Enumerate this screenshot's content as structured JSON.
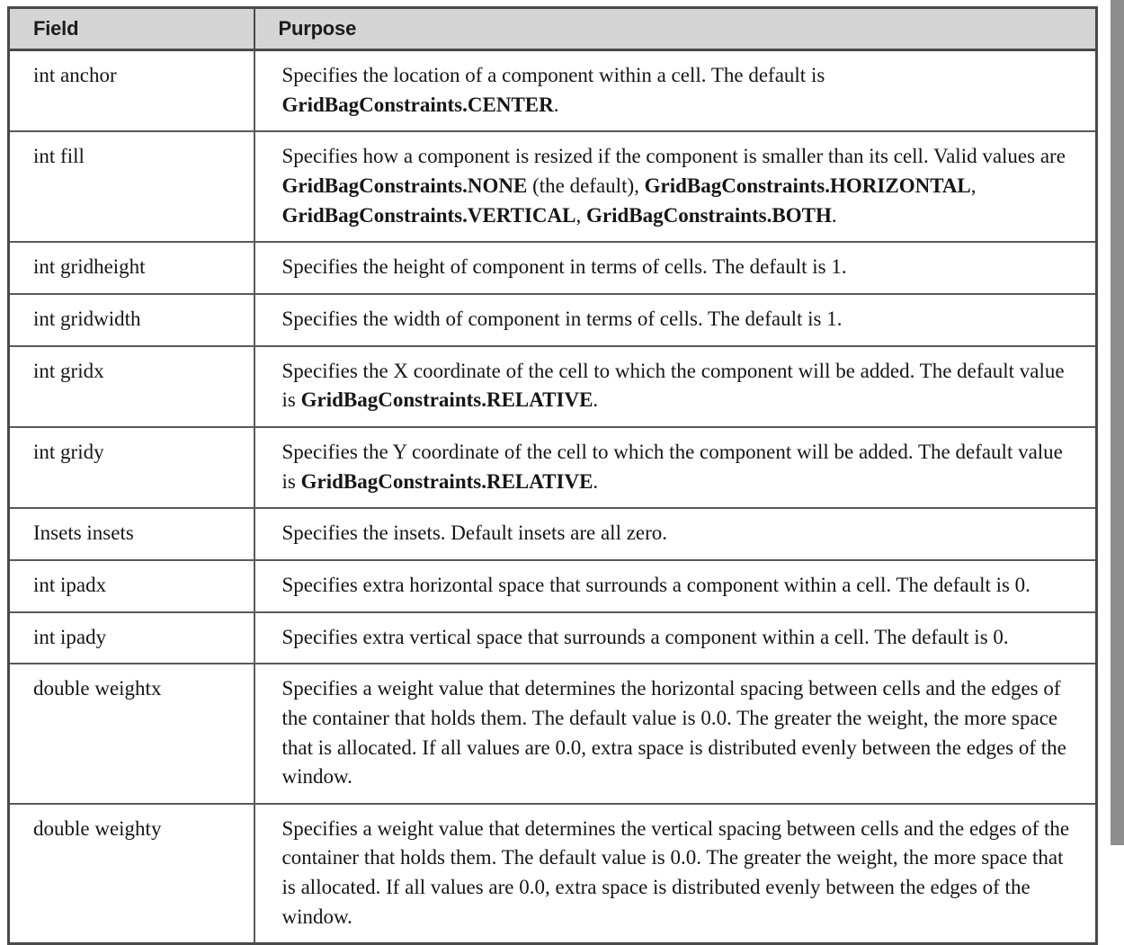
{
  "table": {
    "columns": [
      {
        "key": "field",
        "label": "Field"
      },
      {
        "key": "purpose",
        "label": "Purpose"
      }
    ],
    "colors": {
      "header_background": "#d5d5d5",
      "header_text": "#1b1b1b",
      "body_text": "#161616",
      "border": "#4a4a4a",
      "inner_border": "#5a5a5a",
      "page_background": "#ffffff",
      "page_edge": "#8e8e8e"
    },
    "rows": [
      {
        "field": "int anchor",
        "purpose_parts": [
          {
            "text": "Specifies the location of a component within a cell. The default is ",
            "bold": false
          },
          {
            "text": "GridBagConstraints.CENTER",
            "bold": true
          },
          {
            "text": ".",
            "bold": false
          }
        ],
        "purpose_text": "Specifies the location of a component within a cell. The default is GridBagConstraints.CENTER."
      },
      {
        "field": "int fill",
        "purpose_parts": [
          {
            "text": "Specifies how a component is resized if the component is smaller than its cell. Valid values are ",
            "bold": false
          },
          {
            "text": "GridBagConstraints.NONE",
            "bold": true
          },
          {
            "text": " (the default), ",
            "bold": false
          },
          {
            "text": "GridBagConstraints.HORIZONTAL",
            "bold": true
          },
          {
            "text": ", ",
            "bold": false
          },
          {
            "text": "GridBagConstraints.VERTICAL",
            "bold": true
          },
          {
            "text": ", ",
            "bold": false
          },
          {
            "text": "GridBagConstraints.BOTH",
            "bold": true
          },
          {
            "text": ".",
            "bold": false
          }
        ],
        "purpose_text": "Specifies how a component is resized if the component is smaller than its cell. Valid values are GridBagConstraints.NONE (the default), GridBagConstraints.HORIZONTAL, GridBagConstraints.VERTICAL, GridBagConstraints.BOTH."
      },
      {
        "field": "int gridheight",
        "purpose_parts": [
          {
            "text": "Specifies the height of component in terms of cells. The default is 1.",
            "bold": false
          }
        ],
        "purpose_text": "Specifies the height of component in terms of cells. The default is 1."
      },
      {
        "field": "int gridwidth",
        "purpose_parts": [
          {
            "text": "Specifies the width of component in terms of cells. The default is 1.",
            "bold": false
          }
        ],
        "purpose_text": "Specifies the width of component in terms of cells. The default is 1."
      },
      {
        "field": "int gridx",
        "purpose_parts": [
          {
            "text": "Specifies the X coordinate of the cell to which the component will be added. The default value is ",
            "bold": false
          },
          {
            "text": "GridBagConstraints.RELATIVE",
            "bold": true
          },
          {
            "text": ".",
            "bold": false
          }
        ],
        "purpose_text": "Specifies the X coordinate of the cell to which the component will be added. The default value is GridBagConstraints.RELATIVE."
      },
      {
        "field": "int gridy",
        "purpose_parts": [
          {
            "text": "Specifies the Y coordinate of the cell to which the component will be added. The default value is ",
            "bold": false
          },
          {
            "text": "GridBagConstraints.RELATIVE",
            "bold": true
          },
          {
            "text": ".",
            "bold": false
          }
        ],
        "purpose_text": "Specifies the Y coordinate of the cell to which the component will be added. The default value is GridBagConstraints.RELATIVE."
      },
      {
        "field": "Insets insets",
        "purpose_parts": [
          {
            "text": "Specifies the insets. Default insets are all zero.",
            "bold": false
          }
        ],
        "purpose_text": "Specifies the insets. Default insets are all zero."
      },
      {
        "field": "int ipadx",
        "purpose_parts": [
          {
            "text": "Specifies extra horizontal space that surrounds a component within a cell. The default is 0.",
            "bold": false
          }
        ],
        "purpose_text": "Specifies extra horizontal space that surrounds a component within a cell. The default is 0."
      },
      {
        "field": "int ipady",
        "purpose_parts": [
          {
            "text": "Specifies extra vertical space that surrounds a component within a cell. The default is 0.",
            "bold": false
          }
        ],
        "purpose_text": "Specifies extra vertical space that surrounds a component within a cell. The default is 0."
      },
      {
        "field": "double weightx",
        "purpose_parts": [
          {
            "text": "Specifies a weight value that determines the horizontal spacing between cells and the edges of the container that holds them. The default value is 0.0. The greater the weight, the more space that is allocated. If all values are 0.0, extra space is distributed evenly between the edges of the window.",
            "bold": false
          }
        ],
        "purpose_text": "Specifies a weight value that determines the horizontal spacing between cells and the edges of the container that holds them. The default value is 0.0. The greater the weight, the more space that is allocated. If all values are 0.0, extra space is distributed evenly between the edges of the window."
      },
      {
        "field": "double weighty",
        "purpose_parts": [
          {
            "text": "Specifies a weight value that determines the vertical spacing between cells and the edges of the container that holds them. The default value is 0.0. The greater the weight, the more space that is allocated. If all values are 0.0, extra space is distributed evenly between the edges of the window.",
            "bold": false
          }
        ],
        "purpose_text": "Specifies a weight value that determines the vertical spacing between cells and the edges of the container that holds them. The default value is 0.0. The greater the weight, the more space that is allocated. If all values are 0.0, extra space is distributed evenly between the edges of the window."
      }
    ]
  }
}
